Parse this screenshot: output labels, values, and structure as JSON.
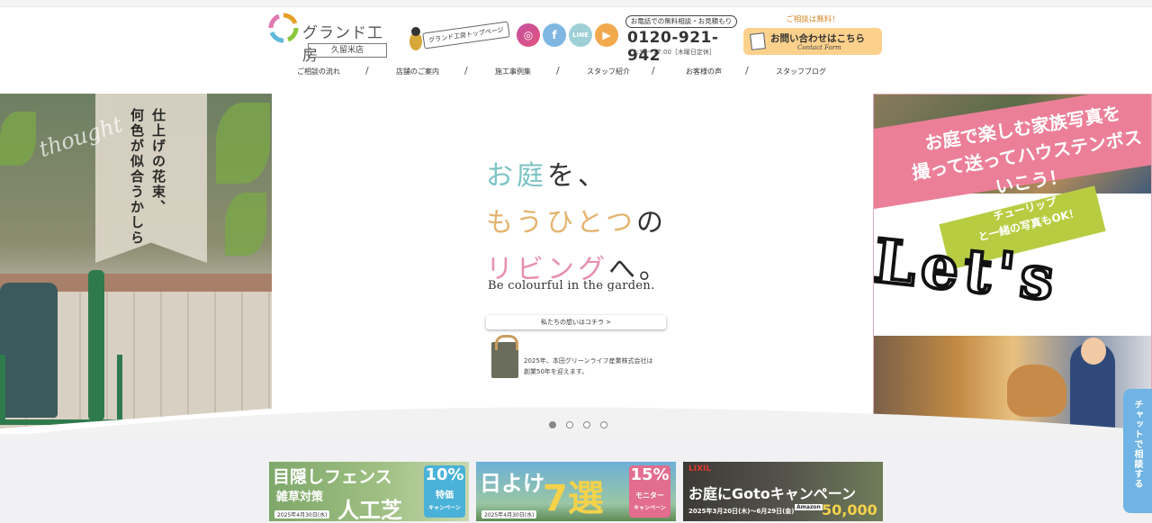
{
  "header": {
    "logo_text": "グランド工房",
    "store_name": "久留米店",
    "toppage_link": "グランド工房トップページ",
    "sns": [
      "instagram-icon",
      "facebook-icon",
      "line-icon",
      "youtube-icon"
    ],
    "phone_label": "お電話での無料相談・お見積もり",
    "phone_number": "0120-921-942",
    "phone_hours": "9:30～17:00［木曜日定休］",
    "contact_note": "ご相談は無料！",
    "contact_label": "お問い合わせはこちら",
    "contact_sub": "Contact Form"
  },
  "nav": {
    "items": [
      "ご相談の流れ",
      "店舗のご案内",
      "施工事例集",
      "スタッフ紹介",
      "お客様の声",
      "スタッフブログ"
    ],
    "separator": "/"
  },
  "hero": {
    "left_text_1": "仕上げの花束、",
    "left_text_2": "何色が似合うかしら",
    "left_script": "thought",
    "catch_1a": "お庭",
    "catch_1b": "を、",
    "catch_2a": "もうひとつ",
    "catch_2b": "の",
    "catch_3a": "リビング",
    "catch_3b": "へ。",
    "tagline": "Be colourful in the garden.",
    "story_button": "私たちの想いはコチラ >",
    "anniversary_1": "2025年、本田グリーンライフ産業株式会社は",
    "anniversary_2": "創業50年を迎えます。",
    "right_head_1": "お庭で楽しむ家族写真を",
    "right_head_2": "撮って送ってハウステンボス",
    "right_head_3": "いこう！",
    "right_sub_1": "チューリップ",
    "right_sub_2": "と一緒の写真もOK！",
    "right_lets": "Let's"
  },
  "slider": {
    "count": 4,
    "active": 0
  },
  "banners": [
    {
      "title_1": "目隠しフェンス",
      "title_2": "雑草対策",
      "title_3": "人工芝",
      "date": "2025年4月30日(水)",
      "percent": "10%",
      "badge_1": "特価",
      "badge_2": "キャンペーン"
    },
    {
      "title_1": "日よけ",
      "title_2": "7選",
      "date": "2025年4月30日(水)",
      "percent": "15%",
      "badge_1": "モニター",
      "badge_2": "キャンペーン"
    },
    {
      "brand": "LIXIL",
      "title_1": "お庭にGotoキャンペーン",
      "date": "2025年3月20日(木)～6月29日(金)",
      "amount": "50,000",
      "amazon": "Amazon"
    }
  ],
  "chat_button": "チャットで相談する",
  "colors": {
    "accent_teal": "#7cc3c4",
    "accent_orange": "#e4b470",
    "accent_pink": "#e68fb0",
    "contact_bg": "#fbd18c",
    "chat_bg": "#6fb4e4"
  }
}
